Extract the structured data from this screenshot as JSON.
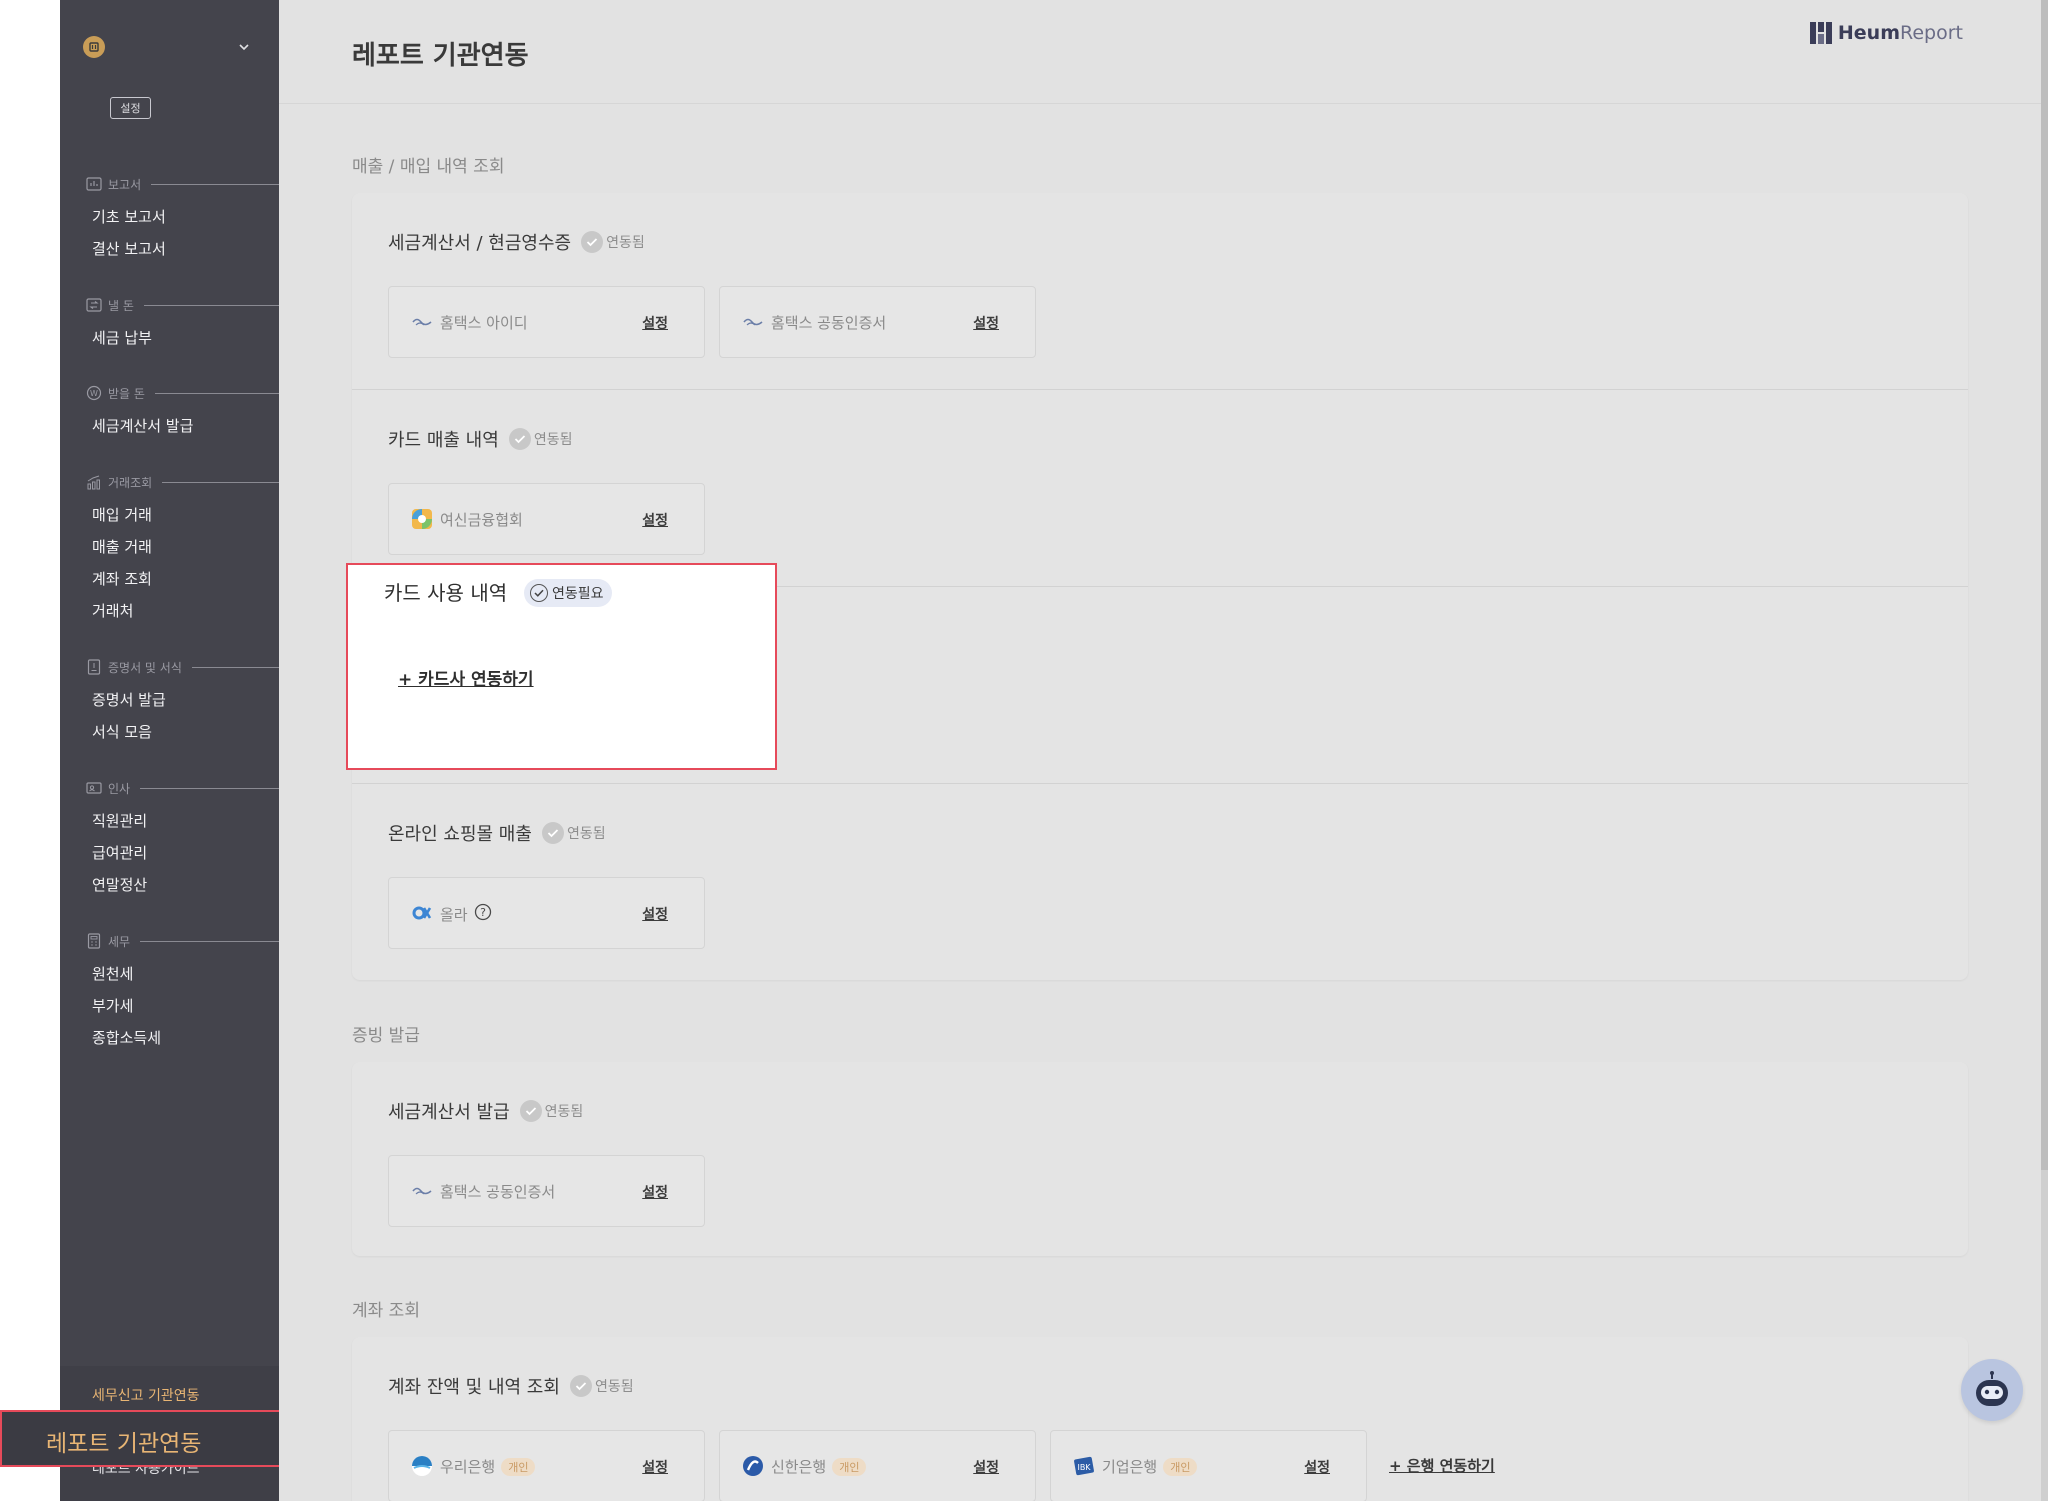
{
  "sidebar": {
    "settings_label": "설정",
    "sections": {
      "report": "보고서",
      "pay": "낼 돈",
      "receive": "받을 돈",
      "trade": "거래조회",
      "cert": "증명서 및 서식",
      "hr": "인사",
      "tax": "세무"
    },
    "items": {
      "basic_report": "기초 보고서",
      "settle_report": "결산 보고서",
      "tax_payment": "세금 납부",
      "tax_invoice_issue": "세금계산서 발급",
      "purchase_trade": "매입 거래",
      "sales_trade": "매출 거래",
      "account_lookup": "계좌 조회",
      "partners": "거래처",
      "cert_issue": "증명서 발급",
      "forms": "서식 모음",
      "employees": "직원관리",
      "payroll": "급여관리",
      "year_end": "연말정산",
      "withholding": "원천세",
      "vat": "부가세",
      "income_tax": "종합소득세"
    },
    "bottom": {
      "tax_link": "세무신고 기관연동",
      "report_link": "레포트 기관연동",
      "guide": "레포트 사용가이드"
    }
  },
  "header": {
    "title": "레포트 기관연동",
    "logo_main": "Heum",
    "logo_sub": "Report"
  },
  "groups": {
    "sales_purchase": "매출 / 매입 내역 조회",
    "issue": "증빙 발급",
    "account": "계좌 조회"
  },
  "sections": {
    "tax_invoice": {
      "title": "세금계산서 / 현금영수증",
      "status": "연동됨",
      "items": [
        {
          "label": "홈택스 아이디",
          "action": "설정"
        },
        {
          "label": "홈택스 공동인증서",
          "action": "설정"
        }
      ]
    },
    "card_sales": {
      "title": "카드 매출 내역",
      "status": "연동됨",
      "items": [
        {
          "label": "여신금융협회",
          "action": "설정"
        }
      ]
    },
    "card_usage": {
      "title": "카드 사용 내역",
      "status": "연동필요",
      "add": "+ 카드사 연동하기"
    },
    "online_mall": {
      "title": "온라인 쇼핑몰 매출",
      "status": "연동됨",
      "items": [
        {
          "label": "올라",
          "action": "설정"
        }
      ]
    },
    "tax_invoice_issue": {
      "title": "세금계산서 발급",
      "status": "연동됨",
      "items": [
        {
          "label": "홈택스 공동인증서",
          "action": "설정"
        }
      ]
    },
    "account_balance": {
      "title": "계좌 잔액 및 내역 조회",
      "status": "연동됨",
      "items": [
        {
          "label": "우리은행",
          "tag": "개인",
          "action": "설정"
        },
        {
          "label": "신한은행",
          "tag": "개인",
          "action": "설정"
        },
        {
          "label": "기업은행",
          "tag": "개인",
          "action": "설정"
        }
      ],
      "add": "+ 은행 연동하기"
    }
  },
  "colors": {
    "sidebar_bg": "#44444c",
    "accent_orange": "#e8b574",
    "highlight_red": "#e64a5a"
  }
}
